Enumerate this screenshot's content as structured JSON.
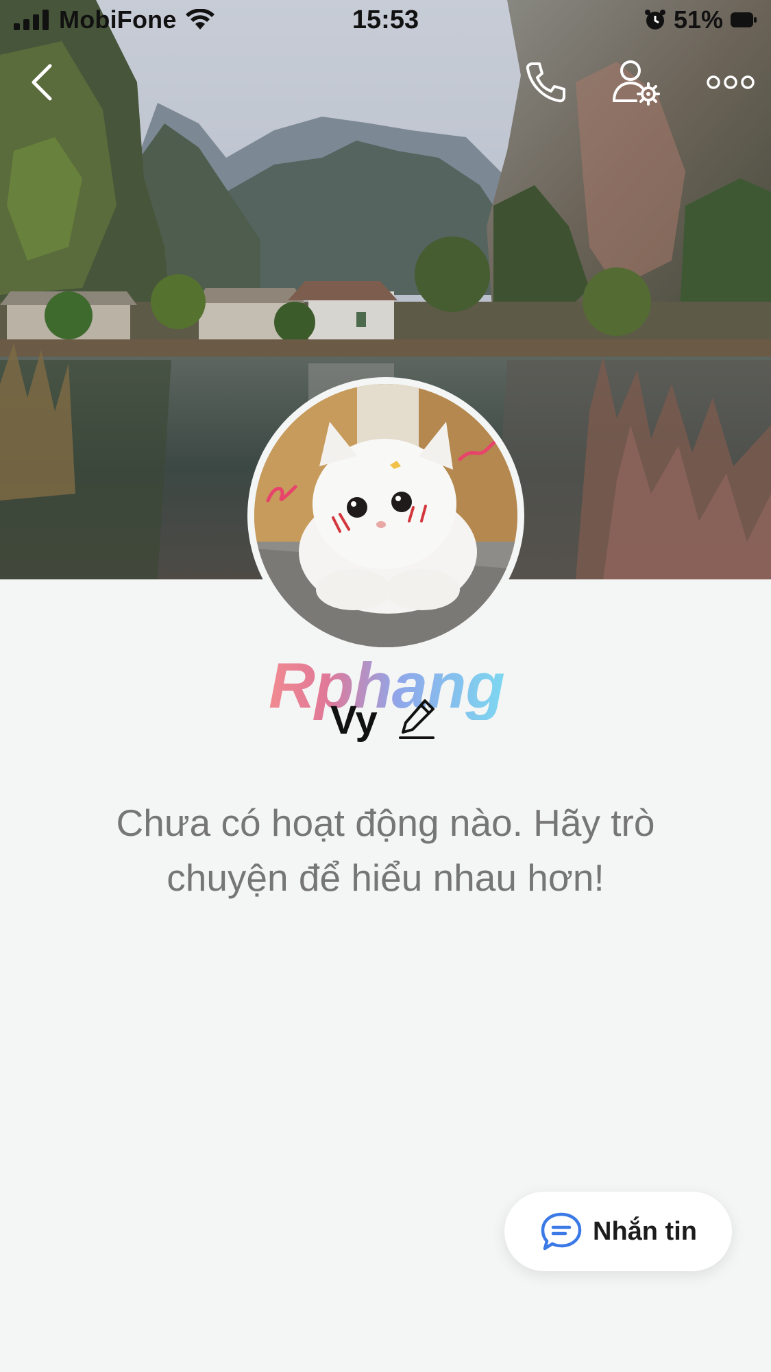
{
  "status_bar": {
    "carrier": "MobiFone",
    "time": "15:53",
    "battery": "51%"
  },
  "profile": {
    "name_badge": "Rphang",
    "display_name": "Vy"
  },
  "empty_state": {
    "line1": "Chưa có hoạt động nào. Hãy trò",
    "line2": "chuyện để hiểu nhau hơn!"
  },
  "actions": {
    "message_label": "Nhắn tin"
  },
  "icons": {
    "back": "chevron-left-icon",
    "call": "phone-icon",
    "settings": "user-settings-icon",
    "more": "more-icon",
    "edit": "pencil-icon",
    "message": "chat-bubble-icon"
  },
  "colors": {
    "background": "#f4f5f5",
    "accent": "#3a79e6",
    "muted_text": "#767676"
  }
}
